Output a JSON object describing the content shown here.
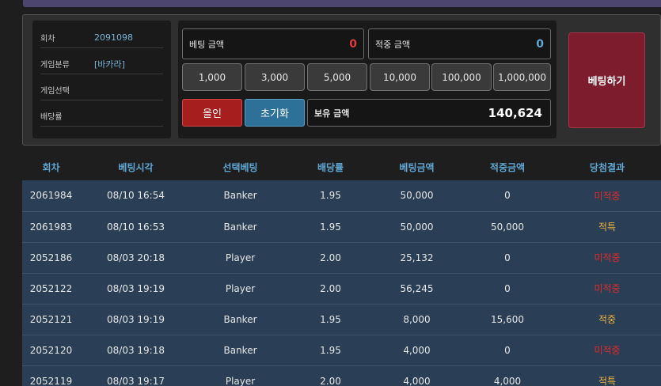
{
  "info": {
    "round_label": "회차",
    "round_value": "2091098",
    "category_label": "게임분류",
    "category_value": "[바카라]",
    "selection_label": "게임선택",
    "selection_value": "",
    "odds_label": "배당률",
    "odds_value": ""
  },
  "controls": {
    "bet_amount_label": "베팅 금액",
    "bet_amount_value": "0",
    "win_amount_label": "적중 금액",
    "win_amount_value": "0",
    "chips": [
      "1,000",
      "3,000",
      "5,000",
      "10,000",
      "100,000",
      "1,000,000"
    ],
    "allin_label": "올인",
    "reset_label": "초기화",
    "balance_label": "보유 금액",
    "balance_value": "140,624",
    "bet_button_label": "베팅하기"
  },
  "colors": {
    "accent_blue": "#5fa8d6",
    "miss": "#e02b2b",
    "hit": "#f0b33c",
    "row_bg": "#2a3f55"
  },
  "history": {
    "headers": [
      "회차",
      "베팅시각",
      "선택베팅",
      "배당률",
      "베팅금액",
      "적중금액",
      "당첨결과"
    ],
    "rows": [
      [
        "2061984",
        "08/10 16:54",
        "Banker",
        "1.95",
        "50,000",
        "0",
        "미적중"
      ],
      [
        "2061983",
        "08/10 16:53",
        "Banker",
        "1.95",
        "50,000",
        "50,000",
        "적특"
      ],
      [
        "2052186",
        "08/03 20:18",
        "Player",
        "2.00",
        "25,132",
        "0",
        "미적중"
      ],
      [
        "2052122",
        "08/03 19:19",
        "Player",
        "2.00",
        "56,245",
        "0",
        "미적중"
      ],
      [
        "2052121",
        "08/03 19:19",
        "Banker",
        "1.95",
        "8,000",
        "15,600",
        "적중"
      ],
      [
        "2052120",
        "08/03 19:18",
        "Banker",
        "1.95",
        "4,000",
        "0",
        "미적중"
      ],
      [
        "2052119",
        "08/03 19:17",
        "Player",
        "2.00",
        "4,000",
        "4,000",
        "적특"
      ]
    ]
  }
}
